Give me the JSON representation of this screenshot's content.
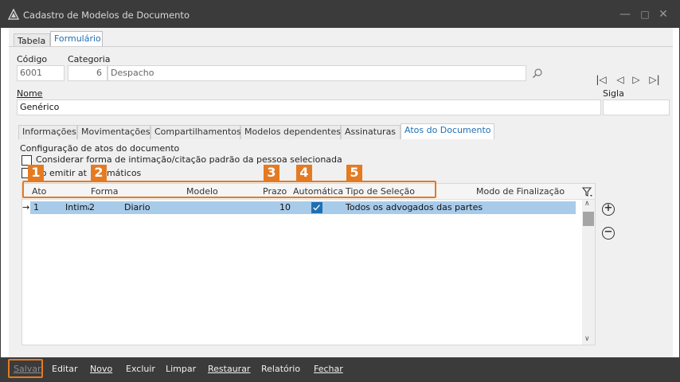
{
  "window": {
    "title": "Cadastro de Modelos de Documento"
  },
  "top_tabs": [
    {
      "label": "Tabela"
    },
    {
      "label": "Formulário"
    }
  ],
  "form": {
    "codigo_label": "Código",
    "codigo_value": "6001",
    "categoria_label": "Categoria",
    "categoria_id": "6",
    "categoria_value": "Despacho",
    "nome_label": "Nome",
    "nome_value": "Genérico",
    "sigla_label": "Sigla",
    "sigla_value": ""
  },
  "sub_tabs": [
    {
      "label": "Informações"
    },
    {
      "label": "Movimentações"
    },
    {
      "label": "Compartilhamentos"
    },
    {
      "label": "Modelos dependentes"
    },
    {
      "label": "Assinaturas"
    },
    {
      "label": "Atos do Documento"
    }
  ],
  "atos": {
    "section_title": "Configuração de atos do documento",
    "checkbox1_label": "Considerar forma de intimação/citação padrão da pessoa selecionada",
    "checkbox2_label": "ão emitir at  utomáticos"
  },
  "grid": {
    "columns": [
      "Ato",
      "Forma",
      "Modelo",
      "Prazo",
      "Automática",
      "Tipo de Seleção",
      "Modo de Finalização"
    ],
    "rows": [
      {
        "ato": "1",
        "forma": "Intima",
        "modelo_id": "2",
        "modelo": "Diario",
        "prazo": "10",
        "automatica": true,
        "tipo_selecao": "Todos os advogados das partes",
        "modo_finalizacao": ""
      }
    ]
  },
  "markers": [
    "1",
    "2",
    "3",
    "4",
    "5"
  ],
  "toolbar": {
    "salvar": "Salvar",
    "editar": "Editar",
    "novo": "Novo",
    "excluir": "Excluir",
    "limpar": "Limpar",
    "restaurar": "Restaurar",
    "relatorio": "Relatório",
    "fechar": "Fechar"
  },
  "colors": {
    "accent": "#1f6fb5",
    "marker": "#e47b22",
    "selected_row": "#a9cbea",
    "titlebar": "#3b3b3b"
  }
}
